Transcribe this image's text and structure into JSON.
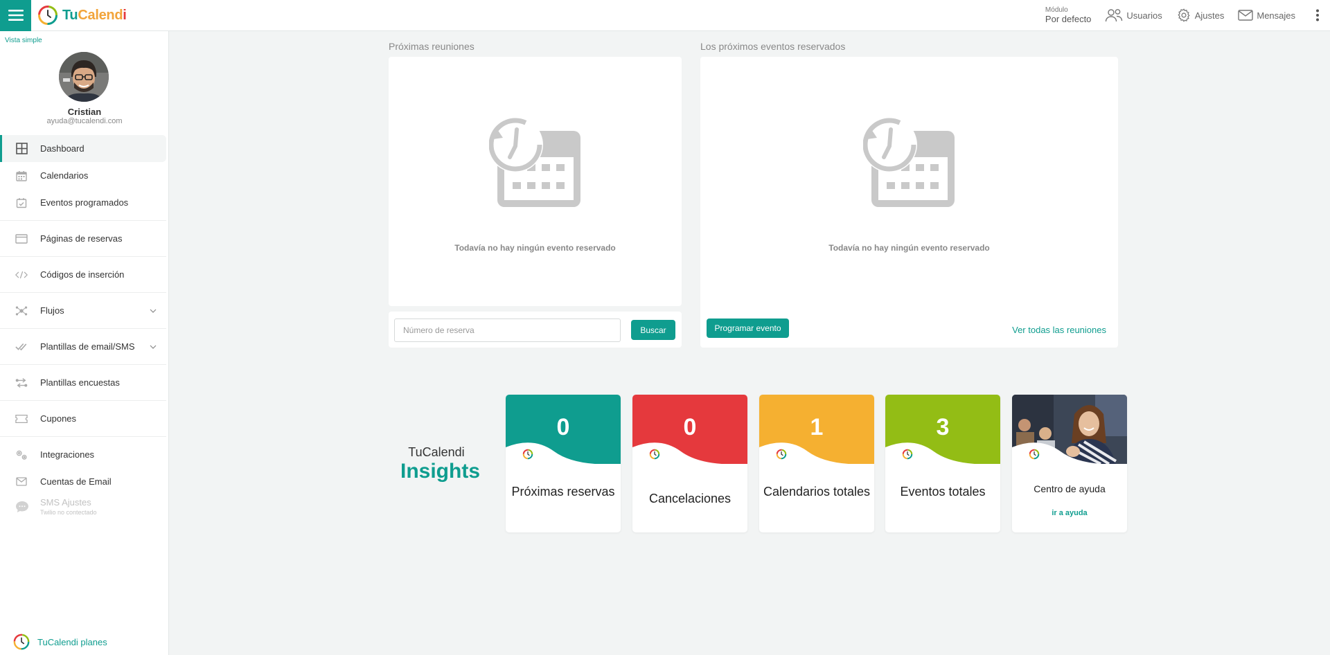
{
  "brand": {
    "part1": "Tu",
    "part2": "Calend",
    "part3": "i"
  },
  "header": {
    "modulo_label": "Módulo",
    "modulo_value": "Por defecto",
    "nav": [
      {
        "label": "Usuarios",
        "icon": "users-icon"
      },
      {
        "label": "Ajustes",
        "icon": "gear-icon"
      },
      {
        "label": "Mensajes",
        "icon": "envelope-icon"
      }
    ]
  },
  "sidebar": {
    "vista_simple": "Vista simple",
    "user_name": "Cristian",
    "user_email": "ayuda@tucalendi.com",
    "items": [
      {
        "label": "Dashboard",
        "icon": "grid-icon"
      },
      {
        "label": "Calendarios",
        "icon": "calendar-icon"
      },
      {
        "label": "Eventos programados",
        "icon": "calendar-check-icon"
      },
      {
        "label": "Páginas de reservas",
        "icon": "browser-window-icon"
      },
      {
        "label": "Códigos de inserción",
        "icon": "code-icon"
      },
      {
        "label": "Flujos",
        "icon": "workflow-icon"
      },
      {
        "label": "Plantillas de email/SMS",
        "icon": "double-check-icon"
      },
      {
        "label": "Plantillas encuestas",
        "icon": "swap-icon"
      },
      {
        "label": "Cupones",
        "icon": "ticket-icon"
      },
      {
        "label": "Integraciones",
        "icon": "gears-icon"
      },
      {
        "label": "Cuentas de Email",
        "icon": "envelope-icon"
      }
    ],
    "sms": {
      "label": "SMS Ajustes",
      "sub": "Twilio no contectado"
    },
    "plans": "TuCalendi planes"
  },
  "meetings": {
    "title": "Próximas reuniones",
    "empty_text": "Todavía no hay ningún evento reservado",
    "search_placeholder": "Número de reserva",
    "search_button": "Buscar"
  },
  "events": {
    "title": "Los próximos eventos reservados",
    "empty_text": "Todavía no hay ningún evento reservado",
    "schedule_button": "Programar evento",
    "view_all": "Ver todas las reuniones"
  },
  "insights": {
    "title_a": "TuCalendi",
    "title_b": "Insights",
    "stats": [
      {
        "value": "0",
        "label": "Próximas reservas",
        "color": "#0f9d8f"
      },
      {
        "value": "0",
        "label": "Cancelaciones",
        "color": "#e5393d"
      },
      {
        "value": "1",
        "label": "Calendarios totales",
        "color": "#f5b031"
      },
      {
        "value": "3",
        "label": "Eventos totales",
        "color": "#93bd15"
      }
    ],
    "help": {
      "title": "Centro de ayuda",
      "link": "ir a ayuda"
    }
  }
}
